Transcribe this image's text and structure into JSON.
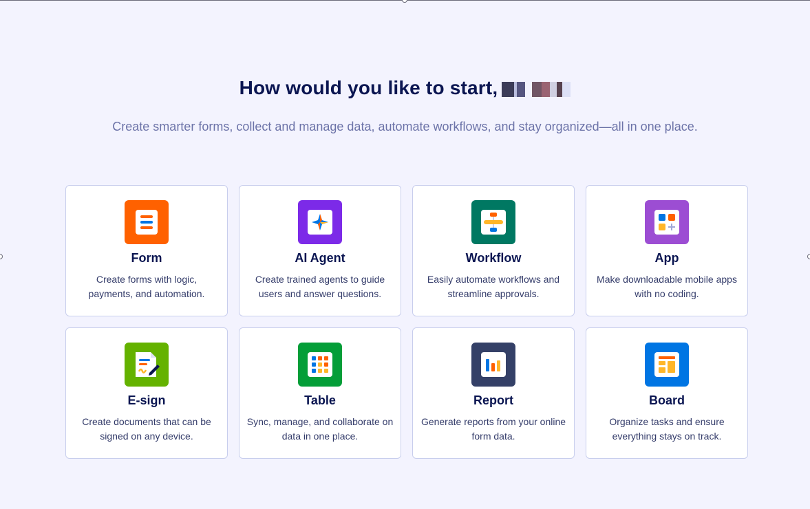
{
  "heading": {
    "title": "How would you like to start,",
    "subtitle": "Create smarter forms, collect and manage data, automate workflows, and stay organized—all in one place."
  },
  "cards": [
    {
      "title": "Form",
      "description": "Create forms with logic, payments, and automation.",
      "icon": "form-icon",
      "color": "#ff6100"
    },
    {
      "title": "AI Agent",
      "description": "Create trained agents to guide users and answer questions.",
      "icon": "ai-agent-icon",
      "color": "#7c2ae8"
    },
    {
      "title": "Workflow",
      "description": "Easily automate workflows and streamline approvals.",
      "icon": "workflow-icon",
      "color": "#007862"
    },
    {
      "title": "App",
      "description": "Make downloadable mobile apps with no coding.",
      "icon": "app-icon",
      "color": "#9c4dd3"
    },
    {
      "title": "E-sign",
      "description": "Create documents that can be signed on any device.",
      "icon": "esign-icon",
      "color": "#64b200"
    },
    {
      "title": "Table",
      "description": "Sync, manage, and collaborate on data in one place.",
      "icon": "table-icon",
      "color": "#049e38"
    },
    {
      "title": "Report",
      "description": "Generate reports from your online form data.",
      "icon": "report-icon",
      "color": "#344067"
    },
    {
      "title": "Board",
      "description": "Organize tasks and ensure everything stays on track.",
      "icon": "board-icon",
      "color": "#0075e3"
    }
  ]
}
